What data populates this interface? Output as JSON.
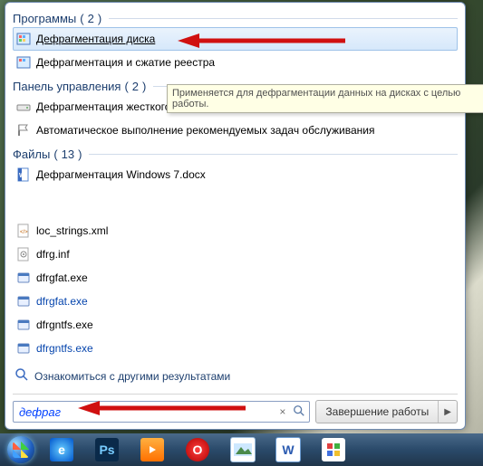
{
  "groups": {
    "programs": {
      "title": "Программы",
      "count": 2
    },
    "control": {
      "title": "Панель управления",
      "count": 2
    },
    "files": {
      "title": "Файлы",
      "count": 13
    }
  },
  "programs": [
    {
      "label": "Дефрагментация диска",
      "selected": true
    },
    {
      "label": "Дефрагментация и сжатие реестра"
    }
  ],
  "control_panel": [
    {
      "label": "Дефрагментация жесткого диска"
    },
    {
      "label": "Автоматическое выполнение рекомендуемых задач обслуживания"
    }
  ],
  "files_top": [
    {
      "label": "Дефрагментация Windows 7.docx",
      "kind": "docx"
    }
  ],
  "files_rest": [
    {
      "label": "loc_strings.xml",
      "kind": "xml"
    },
    {
      "label": "dfrg.inf",
      "kind": "inf"
    },
    {
      "label": "dfrgfat.exe",
      "kind": "exe"
    },
    {
      "label": "dfrgfat.exe",
      "kind": "exe",
      "link": true
    },
    {
      "label": "dfrgntfs.exe",
      "kind": "exe"
    },
    {
      "label": "dfrgntfs.exe",
      "kind": "exe",
      "link": true
    }
  ],
  "tooltip": "Применяется для дефрагментации данных на дисках с целью работы.",
  "see_more": "Ознакомиться с другими результатами",
  "search": {
    "value": "дефраг"
  },
  "shutdown": {
    "label": "Завершение работы"
  }
}
